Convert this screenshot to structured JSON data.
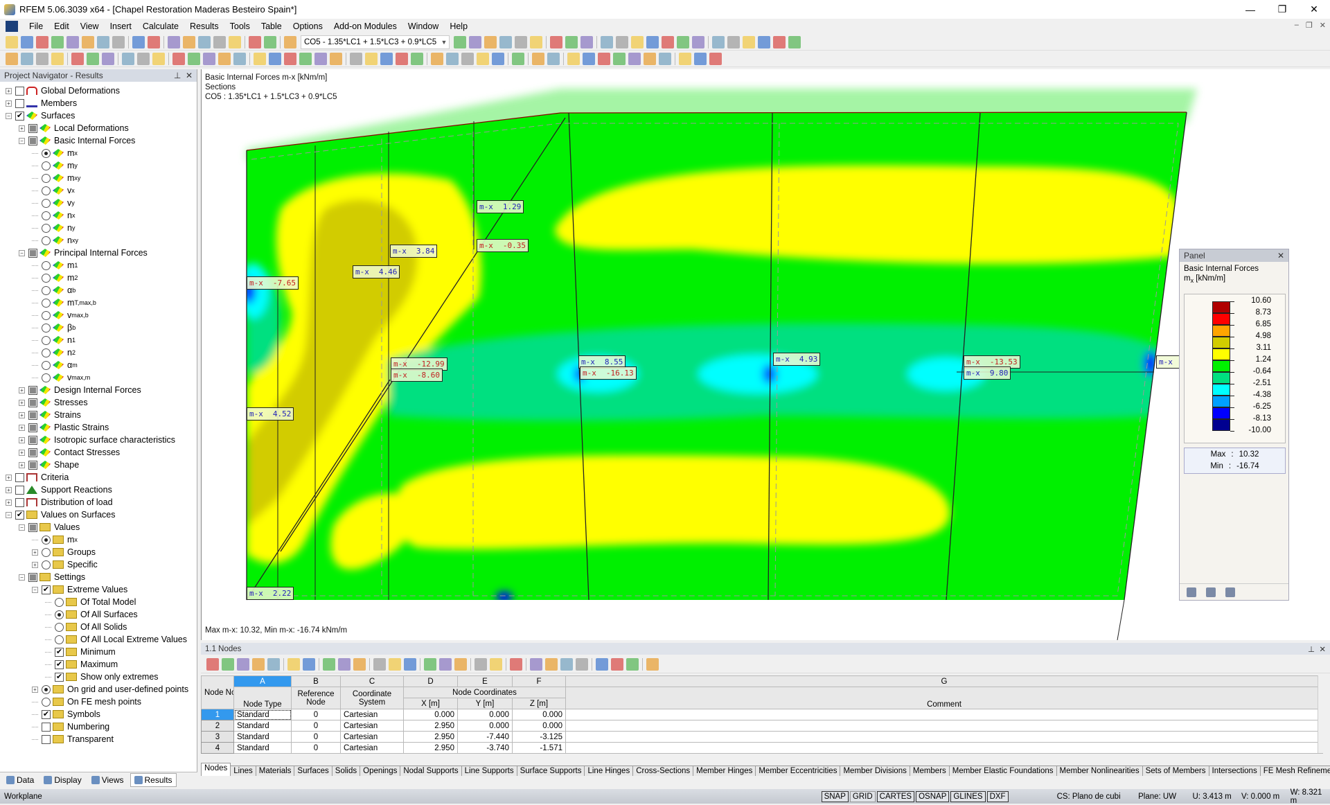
{
  "window": {
    "title": "RFEM 5.06.3039 x64 - [Chapel Restoration Maderas Besteiro Spain*]",
    "controls": [
      "minimize-icon",
      "restore-icon",
      "close-icon"
    ]
  },
  "menu": [
    "File",
    "Edit",
    "View",
    "Insert",
    "Calculate",
    "Results",
    "Tools",
    "Table",
    "Options",
    "Add-on Modules",
    "Window",
    "Help"
  ],
  "toolbar1": {
    "combo_value": "CO5 - 1.35*LC1 + 1.5*LC3 + 0.9*LC5",
    "icons_before": [
      "new-icon",
      "open-icon",
      "archive-icon",
      "save-all-icon",
      "save-icon",
      "print-report-icon",
      "print-icon",
      "preview-icon",
      "|",
      "undo-icon",
      "redo-icon",
      "|",
      "edit-icon",
      "target-icon",
      "target2-icon",
      "select-icon",
      "window-icon",
      "|",
      "table-view-icon",
      "table-icon",
      "|",
      "load-case-icon"
    ],
    "icons_after": [
      "prev-icon",
      "next-icon",
      "results-icon",
      "values-icon",
      "show-results-icon",
      "show-values-icon",
      "|",
      "deformation-icon",
      "sections-icon",
      "sections2-icon",
      "|",
      "render-icon",
      "grid-icon",
      "mesh-icon",
      "support-icon",
      "panel-icon",
      "filter-icon",
      "wire-icon",
      "|",
      "tool1-icon",
      "tool2-icon",
      "delete-icon",
      "tool3-icon",
      "tool4-icon",
      "tool5-icon"
    ]
  },
  "toolbar2": {
    "icons": [
      "node-icon",
      "line-icon",
      "member-icon",
      "support-icon",
      "|",
      "load1-icon",
      "load2-icon",
      "load3-icon",
      "|",
      "dim-icon",
      "dim2-icon",
      "grid-icon",
      "|",
      "surface-icon",
      "opening-icon",
      "solid-icon",
      "shell-icon",
      "copy-icon",
      "|",
      "move-icon",
      "mirror-icon",
      "mesh1-icon",
      "mesh2-icon",
      "mesh3-icon",
      "mesh4-icon",
      "|",
      "zoom-all-icon",
      "zoom-icon",
      "zoom-out-icon",
      "view-iso-icon",
      "view-3d-icon",
      "|",
      "view-x-icon",
      "view-y-icon",
      "view-z-icon",
      "view-minus-x-icon",
      "color-icon",
      "|",
      "pencil-icon",
      "|",
      "axis-icon",
      "beam-icon",
      "|",
      "tool-a-icon",
      "tool-b-icon",
      "tool-c-icon",
      "tool-d-icon",
      "tool-e-icon",
      "tool-f-icon",
      "tool-g-icon",
      "|",
      "tool-h-icon",
      "tool-i-icon",
      "tool-j-icon"
    ]
  },
  "navigator": {
    "title": "Project Navigator - Results",
    "tree": [
      {
        "l": 0,
        "e": "+",
        "c": "box",
        "i": "def",
        "t": "Global Deformations"
      },
      {
        "l": 0,
        "e": "+",
        "c": "box",
        "i": "mem",
        "t": "Members"
      },
      {
        "l": 0,
        "e": "-",
        "c": "checked",
        "i": "surf",
        "t": "Surfaces"
      },
      {
        "l": 1,
        "e": "+",
        "c": "part",
        "i": "surf",
        "t": "Local Deformations"
      },
      {
        "l": 1,
        "e": "-",
        "c": "part",
        "i": "surf",
        "t": "Basic Internal Forces"
      },
      {
        "l": 2,
        "c": "radio-on",
        "i": "surf",
        "t": "m",
        "s": "x"
      },
      {
        "l": 2,
        "c": "radio",
        "i": "surf",
        "t": "m",
        "s": "y"
      },
      {
        "l": 2,
        "c": "radio",
        "i": "surf",
        "t": "m",
        "s": "xy"
      },
      {
        "l": 2,
        "c": "radio",
        "i": "surf",
        "t": "v",
        "s": "x"
      },
      {
        "l": 2,
        "c": "radio",
        "i": "surf",
        "t": "v",
        "s": "y"
      },
      {
        "l": 2,
        "c": "radio",
        "i": "surf",
        "t": "n",
        "s": "x"
      },
      {
        "l": 2,
        "c": "radio",
        "i": "surf",
        "t": "n",
        "s": "y"
      },
      {
        "l": 2,
        "c": "radio",
        "i": "surf",
        "t": "n",
        "s": "xy"
      },
      {
        "l": 1,
        "e": "-",
        "c": "part",
        "i": "surf",
        "t": "Principal Internal Forces"
      },
      {
        "l": 2,
        "c": "radio",
        "i": "surf",
        "t": "m",
        "s": "1"
      },
      {
        "l": 2,
        "c": "radio",
        "i": "surf",
        "t": "m",
        "s": "2"
      },
      {
        "l": 2,
        "c": "radio",
        "i": "surf",
        "t": "α",
        "s": "b"
      },
      {
        "l": 2,
        "c": "radio",
        "i": "surf",
        "t": "m",
        "s": "T,max,b"
      },
      {
        "l": 2,
        "c": "radio",
        "i": "surf",
        "t": "v",
        "s": "max,b"
      },
      {
        "l": 2,
        "c": "radio",
        "i": "surf",
        "t": "β",
        "s": "b"
      },
      {
        "l": 2,
        "c": "radio",
        "i": "surf",
        "t": "n",
        "s": "1"
      },
      {
        "l": 2,
        "c": "radio",
        "i": "surf",
        "t": "n",
        "s": "2"
      },
      {
        "l": 2,
        "c": "radio",
        "i": "surf",
        "t": "α",
        "s": "m"
      },
      {
        "l": 2,
        "c": "radio",
        "i": "surf",
        "t": "v",
        "s": "max,m"
      },
      {
        "l": 1,
        "e": "+",
        "c": "part",
        "i": "surf",
        "t": "Design Internal Forces"
      },
      {
        "l": 1,
        "e": "+",
        "c": "part",
        "i": "surf",
        "t": "Stresses"
      },
      {
        "l": 1,
        "e": "+",
        "c": "part",
        "i": "surf",
        "t": "Strains"
      },
      {
        "l": 1,
        "e": "+",
        "c": "part",
        "i": "surf",
        "t": "Plastic Strains"
      },
      {
        "l": 1,
        "e": "+",
        "c": "part",
        "i": "surf",
        "t": "Isotropic surface characteristics"
      },
      {
        "l": 1,
        "e": "+",
        "c": "part",
        "i": "surf",
        "t": "Contact Stresses"
      },
      {
        "l": 1,
        "e": "+",
        "c": "part",
        "i": "surf",
        "t": "Shape"
      },
      {
        "l": 0,
        "e": "+",
        "c": "box",
        "i": "crit",
        "t": "Criteria"
      },
      {
        "l": 0,
        "e": "+",
        "c": "box",
        "i": "sup",
        "t": "Support Reactions"
      },
      {
        "l": 0,
        "e": "+",
        "c": "box",
        "i": "crit",
        "t": "Distribution of load"
      },
      {
        "l": 0,
        "e": "-",
        "c": "checked",
        "i": "val",
        "t": "Values on Surfaces"
      },
      {
        "l": 1,
        "e": "-",
        "c": "part",
        "i": "val",
        "t": "Values"
      },
      {
        "l": 2,
        "c": "radio-on",
        "i": "val",
        "t": "m",
        "s": "x"
      },
      {
        "l": 2,
        "e": "+",
        "c": "radio",
        "i": "val",
        "t": "Groups"
      },
      {
        "l": 2,
        "e": "+",
        "c": "radio",
        "i": "val",
        "t": "Specific"
      },
      {
        "l": 1,
        "e": "-",
        "c": "part",
        "i": "val",
        "t": "Settings"
      },
      {
        "l": 2,
        "e": "-",
        "c": "checked",
        "i": "val",
        "t": "Extreme Values"
      },
      {
        "l": 3,
        "c": "radio",
        "i": "val",
        "t": "Of Total Model"
      },
      {
        "l": 3,
        "c": "radio-on",
        "i": "val",
        "t": "Of All Surfaces"
      },
      {
        "l": 3,
        "c": "radio",
        "i": "val",
        "t": "Of All Solids"
      },
      {
        "l": 3,
        "c": "radio",
        "i": "val",
        "t": "Of All Local Extreme Values"
      },
      {
        "l": 3,
        "c": "checked",
        "i": "val",
        "t": "Minimum"
      },
      {
        "l": 3,
        "c": "checked",
        "i": "val",
        "t": "Maximum"
      },
      {
        "l": 3,
        "c": "checked",
        "i": "val",
        "t": "Show only extremes"
      },
      {
        "l": 2,
        "e": "+",
        "c": "radio-on",
        "i": "val",
        "t": "On grid and user-defined points"
      },
      {
        "l": 2,
        "c": "radio",
        "i": "val",
        "t": "On FE mesh points"
      },
      {
        "l": 2,
        "c": "checked",
        "i": "val",
        "t": "Symbols"
      },
      {
        "l": 2,
        "c": "box",
        "i": "val",
        "t": "Numbering"
      },
      {
        "l": 2,
        "c": "box",
        "i": "val",
        "t": "Transparent"
      }
    ],
    "tabs": [
      {
        "label": "Data",
        "active": false
      },
      {
        "label": "Display",
        "active": false
      },
      {
        "label": "Views",
        "active": false
      },
      {
        "label": "Results",
        "active": true
      }
    ]
  },
  "viewport": {
    "info": [
      "Basic Internal Forces m-x [kNm/m]",
      "Sections",
      "CO5 : 1.35*LC1 + 1.5*LC3 + 0.9*LC5"
    ],
    "footer": "Max m-x: 10.32, Min m-x: -16.74 kNm/m",
    "labels": [
      {
        "name": "m-x",
        "value": "1.29",
        "sign": "pos"
      },
      {
        "name": "m-x",
        "value": "-0.35",
        "sign": "neg"
      },
      {
        "name": "m-x",
        "value": "3.84",
        "sign": "pos"
      },
      {
        "name": "m-x",
        "value": "4.46",
        "sign": "pos"
      },
      {
        "name": "m-x",
        "value": "-7.65",
        "sign": "neg"
      },
      {
        "name": "m-x",
        "value": "-12.99",
        "sign": "neg"
      },
      {
        "name": "m-x",
        "value": "-8.60",
        "sign": "neg"
      },
      {
        "name": "m-x",
        "value": "8.55",
        "sign": "pos"
      },
      {
        "name": "m-x",
        "value": "-16.13",
        "sign": "neg"
      },
      {
        "name": "m-x",
        "value": "4.93",
        "sign": "pos"
      },
      {
        "name": "m-x",
        "value": "-13.53",
        "sign": "neg"
      },
      {
        "name": "m-x",
        "value": "9.80",
        "sign": "pos"
      },
      {
        "name": "m-x",
        "value": "",
        "sign": "pos"
      },
      {
        "name": "m-x",
        "value": "4.52",
        "sign": "pos"
      },
      {
        "name": "m-x",
        "value": "2.22",
        "sign": "pos"
      }
    ]
  },
  "panel": {
    "title": "Panel",
    "heading": "Basic Internal Forces",
    "unit_symbol": "m",
    "unit_sub": "x",
    "unit": "[kNm/m]",
    "legend_values": [
      "10.60",
      "8.73",
      "6.85",
      "4.98",
      "3.11",
      "1.24",
      "-0.64",
      "-2.51",
      "-4.38",
      "-6.25",
      "-8.13",
      "-10.00"
    ],
    "legend_colors": [
      "#b00000",
      "#ff0000",
      "#ffa500",
      "#d2cc00",
      "#ffff00",
      "#00f000",
      "#00e080",
      "#00ffff",
      "#00a0ff",
      "#0000ff",
      "#000090"
    ],
    "max_label": "Max",
    "max": "10.32",
    "min_label": "Min",
    "min": "-16.74"
  },
  "table": {
    "title": "1.1 Nodes",
    "col_letters": [
      "A",
      "B",
      "C",
      "D",
      "E",
      "F",
      "G"
    ],
    "headers": {
      "no": "Node No.",
      "type": "Node Type",
      "ref": "Reference Node",
      "cs": "Coordinate System",
      "coords": "Node Coordinates",
      "x": "X [m]",
      "y": "Y [m]",
      "z": "Z [m]",
      "comment": "Comment"
    },
    "rows": [
      {
        "no": "1",
        "type": "Standard",
        "ref": "0",
        "cs": "Cartesian",
        "x": "0.000",
        "y": "0.000",
        "z": "0.000",
        "comment": ""
      },
      {
        "no": "2",
        "type": "Standard",
        "ref": "0",
        "cs": "Cartesian",
        "x": "2.950",
        "y": "0.000",
        "z": "0.000",
        "comment": ""
      },
      {
        "no": "3",
        "type": "Standard",
        "ref": "0",
        "cs": "Cartesian",
        "x": "2.950",
        "y": "-7.440",
        "z": "-3.125",
        "comment": ""
      },
      {
        "no": "4",
        "type": "Standard",
        "ref": "0",
        "cs": "Cartesian",
        "x": "2.950",
        "y": "-3.740",
        "z": "-1.571",
        "comment": ""
      }
    ],
    "tabs": [
      "Nodes",
      "Lines",
      "Materials",
      "Surfaces",
      "Solids",
      "Openings",
      "Nodal Supports",
      "Line Supports",
      "Surface Supports",
      "Line Hinges",
      "Cross-Sections",
      "Member Hinges",
      "Member Eccentricities",
      "Member Divisions",
      "Members",
      "Member Elastic Foundations",
      "Member Nonlinearities",
      "Sets of Members",
      "Intersections",
      "FE Mesh Refinements"
    ],
    "active_tab": "Nodes",
    "toolbar_icons": [
      "excel-icon",
      "import-icon",
      "export-icon",
      "filter-icon",
      "color-icon",
      "|",
      "prev-table-icon",
      "next-table-icon",
      "|",
      "select-icon",
      "edit-icon",
      "refresh-icon",
      "|",
      "insert-row-icon",
      "delete-row-icon",
      "sort-icon",
      "|",
      "cut-icon",
      "copy-icon",
      "paste-icon",
      "|",
      "columns-icon",
      "rows-icon",
      "|",
      "graphics-icon",
      "|",
      "view-icon",
      "chart-icon",
      "xls-icon",
      "calc-icon",
      "|",
      "formula-icon",
      "fx-icon",
      "fx-off-icon",
      "|",
      "lock-icon"
    ]
  },
  "status": {
    "left": "Workplane",
    "toggles": [
      {
        "label": "SNAP",
        "on": true
      },
      {
        "label": "GRID",
        "on": false
      },
      {
        "label": "CARTES",
        "on": true
      },
      {
        "label": "OSNAP",
        "on": true
      },
      {
        "label": "GLINES",
        "on": true
      },
      {
        "label": "DXF",
        "on": true
      }
    ],
    "cs": "CS: Plano de cubi",
    "plane": "Plane: UW",
    "u": "U: 3.413 m",
    "v": "V: 0.000 m",
    "w": "W: 8.321 m"
  }
}
